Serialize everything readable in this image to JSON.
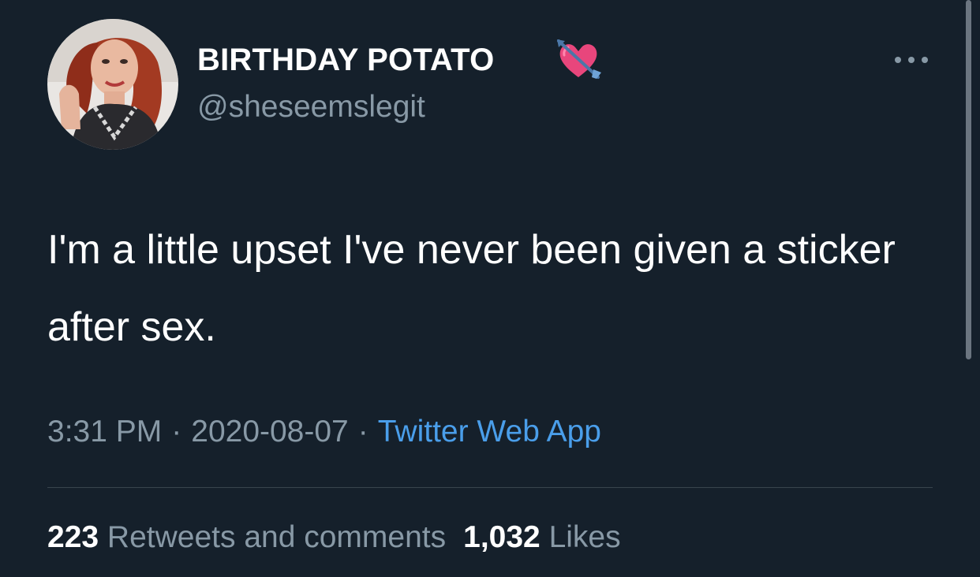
{
  "tweet": {
    "display_name": "BIRTHDAY POTATO",
    "handle": "@sheseemslegit",
    "name_emoji_icon": "heart-with-arrow-icon",
    "text": "I'm a little upset I've never been given a sticker after sex.",
    "time": "3:31 PM",
    "date": "2020-08-07",
    "separator": "·",
    "source": "Twitter Web App",
    "retweets_count": "223",
    "retweets_label": "Retweets and comments",
    "likes_count": "1,032",
    "likes_label": "Likes"
  },
  "icons": {
    "more": "more-options-icon",
    "avatar": "profile-photo"
  },
  "colors": {
    "background": "#15202b",
    "primary_text": "#ffffff",
    "secondary_text": "#8899a6",
    "link": "#4a9eea",
    "divider": "#38444d"
  }
}
